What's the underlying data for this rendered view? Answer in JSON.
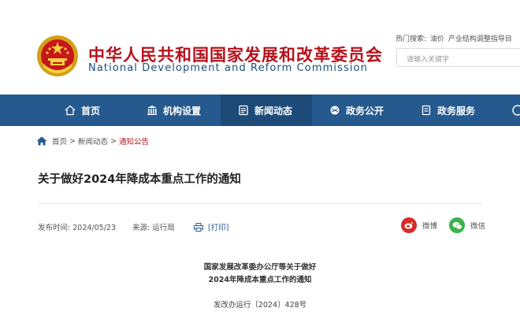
{
  "header": {
    "title_cn": "中华人民共和国国家发展和改革委员会",
    "title_en": "National Development and Reform Commission",
    "hot_search_label": "热门搜索:",
    "hot_search_items": [
      "油价",
      "产业结构调整指导目"
    ],
    "search_placeholder": "请输入关键字"
  },
  "nav": {
    "items": [
      {
        "label": "首页",
        "icon": "home-icon"
      },
      {
        "label": "机构设置",
        "icon": "building-icon"
      },
      {
        "label": "新闻动态",
        "icon": "news-icon"
      },
      {
        "label": "政务公开",
        "icon": "globe-icon"
      },
      {
        "label": "政务服务",
        "icon": "service-doc-icon"
      }
    ]
  },
  "breadcrumb": {
    "home": "首页",
    "sep": ">",
    "level2": "新闻动态",
    "current": "通知公告"
  },
  "article": {
    "title": "关于做好2024年降成本重点工作的通知",
    "publish_time_label": "发布时间:",
    "publish_time": "2024/05/23",
    "source_label": "来源:",
    "source": "运行局",
    "print_label": "[打印]",
    "share_weibo": "微博",
    "share_wechat": "微信",
    "doc_header_line1": "国家发展改革委办公厅等关于做好",
    "doc_header_line2": "2024年降成本重点工作的通知",
    "doc_number": "发改办运行〔2024〕428号"
  },
  "colors": {
    "brand_red": "#b5121b",
    "nav_blue": "#26598e",
    "nav_active": "#1e4a78"
  }
}
